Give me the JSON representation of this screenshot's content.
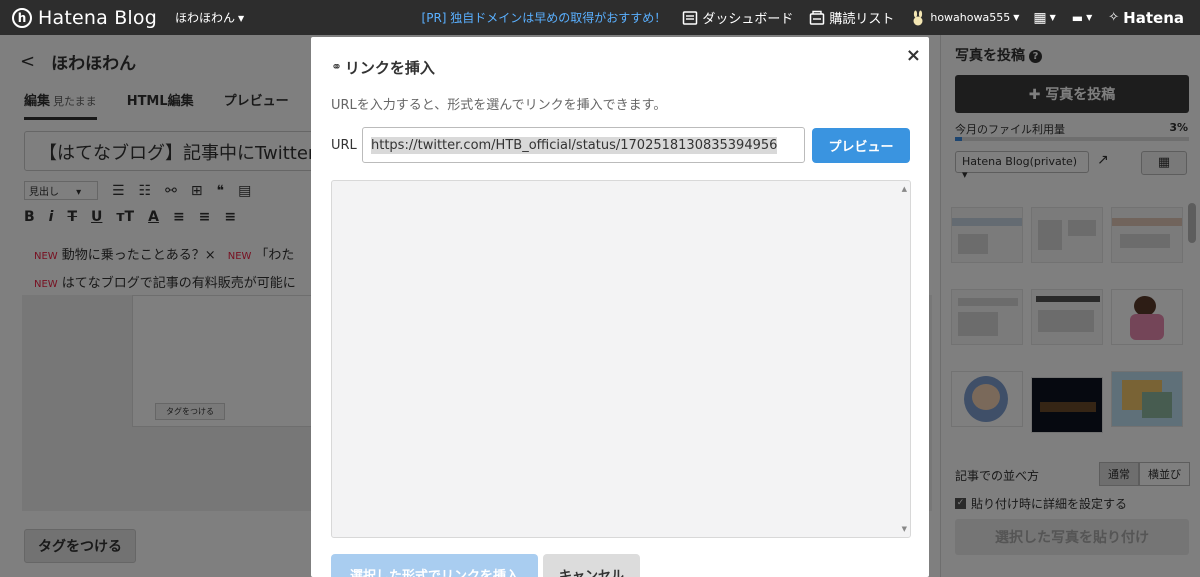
{
  "topbar": {
    "brand": "Hatena Blog",
    "blog_name": "ほわほわん",
    "pr_text": "[PR] 独自ドメインは早めの取得がおすすめ！",
    "dashboard": "ダッシュボード",
    "subscriptions": "購読リスト",
    "username": "howahowa555",
    "hatena": "Hatena"
  },
  "editor": {
    "blog_title": "ほわほわん",
    "tabs": [
      {
        "label": "編集",
        "sub": "見たまま"
      },
      {
        "label": "HTML編集"
      },
      {
        "label": "プレビュー"
      }
    ],
    "article_title": "【はてなブログ】記事中にTwitter",
    "style_select": "見出し",
    "news": [
      {
        "badge": "NEW",
        "text": "動物に乗ったことある？×"
      },
      {
        "badge": "NEW",
        "text": "「わた"
      },
      {
        "badge": "NEW",
        "text": "はてなブログで記事の有料販売が可能に"
      }
    ],
    "tag_mini": "タグをつける",
    "tag_button": "タグをつける"
  },
  "sidebar": {
    "title": "写真を投稿",
    "post_button": "✚ 写真を投稿",
    "usage_label": "今月のファイル利用量",
    "usage_percent": "3%",
    "usage_fraction": 0.03,
    "album": "Hatena Blog(private)",
    "sort_label": "記事での並べ方",
    "sort_options": [
      "通常",
      "横並び"
    ],
    "sort_active": 0,
    "paste_detail": "貼り付け時に詳細を設定する",
    "paste_button": "選択した写真を貼り付け"
  },
  "modal": {
    "title": "リンクを挿入",
    "description": "URLを入力すると、形式を選んでリンクを挿入できます。",
    "url_label": "URL",
    "url_value": "https://twitter.com/HTB_official/status/1702518130835394956",
    "preview_button": "プレビュー",
    "insert_button": "選択した形式でリンクを挿入",
    "cancel_button": "キャンセル"
  },
  "icons": {
    "close": "close-icon",
    "link": "link-icon",
    "help": "help-icon",
    "external": "external-link-icon",
    "grid": "grid-icon",
    "dashboard": "dashboard-icon",
    "subscriptions": "subscription-icon",
    "avatar": "rabbit-avatar-icon"
  },
  "colors": {
    "topbar": "#2d2d2d",
    "pr_link": "#5ab0ff",
    "primary_button": "#3a94e0",
    "disabled_primary": "#a9cdf0",
    "post_button": "#3a3a3a"
  }
}
